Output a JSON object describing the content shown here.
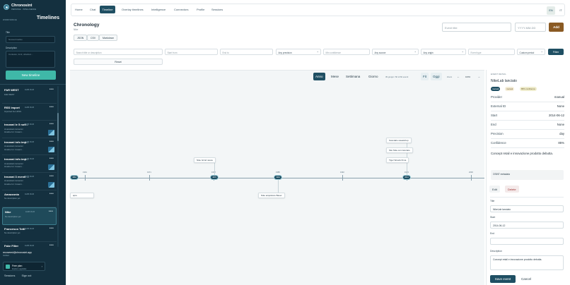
{
  "app": {
    "name": "Chronosint",
    "subtitle": "PERSONAL · INTELLIGENCE"
  },
  "sidebar": {
    "workspace_label": "WORKSPACE",
    "section_title": "Timelines",
    "title_label": "Title",
    "title_placeholder": "Nuova timeline",
    "description_label": "Description",
    "description_placeholder": "Contesto, fonti, obiettivo...",
    "new_button": "New timeline",
    "timelines": [
      {
        "name": "FAR WEST",
        "date": "11/08 16:26",
        "desc": "FAR WEST",
        "desc2": "",
        "thumb": false
      },
      {
        "name": "RSS import",
        "date": "11/08 16:26",
        "desc": "Imported from RSS",
        "desc2": "",
        "thumb": false
      },
      {
        "name": "trovami le 5 noti...",
        "date": "11/08 16:26",
        "desc": "AI-assisted connector",
        "desc2": "timeline for: trovami...",
        "thumb": true
      },
      {
        "name": "trovami info imp...",
        "date": "11/08 16:26",
        "desc": "AI-assisted connector",
        "desc2": "timeline for: trovami...",
        "thumb": true
      },
      {
        "name": "trovami info imp...",
        "date": "11/08 16:26",
        "desc": "AI-assisted connector",
        "desc2": "timeline for: trovami...",
        "thumb": true
      },
      {
        "name": "trovami 3 eventi ...",
        "date": "11/08 16:26",
        "desc": "AI-assisted connector",
        "desc2": "timeline for: trovami...",
        "thumb": true
      },
      {
        "name": "Amazzonia",
        "date": "11/08 16:26",
        "desc": "No description yet",
        "desc2": "",
        "thumb": false
      },
      {
        "name": "Nike",
        "date": "11/08 16:26",
        "desc": "No description yet",
        "desc2": "",
        "thumb": false,
        "active": true
      },
      {
        "name": "Francesco Totti",
        "date": "11/08 16:26",
        "desc": "No description yet",
        "desc2": "",
        "thumb": false
      },
      {
        "name": "Fake Filter",
        "date": "11/08 16:26",
        "desc": "No description yet",
        "desc2": "",
        "thumb": false
      }
    ],
    "account_email": "recovered@chronosint.app",
    "account_role": "Verified",
    "plan_name": "Free plan",
    "plan_sub": "Explore upgrades",
    "footer": {
      "sessions": "Sessions",
      "signout": "Sign out"
    }
  },
  "nav": {
    "items": [
      "Home",
      "Chat",
      "Timeline",
      "Overlay timelines",
      "Intelligence",
      "Connectors",
      "Profile",
      "Sessions"
    ],
    "active": "Timeline",
    "lang": [
      "EN",
      "IT"
    ]
  },
  "header": {
    "title": "Chronology",
    "subtitle": "Nike",
    "export": [
      "JSON",
      "CSV",
      "Markdown"
    ],
    "event_title_placeholder": "Event title",
    "date_placeholder": "YYYY-MM-DD",
    "add_label": "Add"
  },
  "filters": {
    "search_placeholder": "Search title or description",
    "start_placeholder": "Start from",
    "end_placeholder": "End to",
    "precision": "Any precision",
    "min_conf_placeholder": "Min confidence",
    "source": "Any source",
    "origin": "Any origin",
    "event_type_placeholder": "Event type",
    "period": "Custom period",
    "filter_button": "Filter",
    "reset_button": "Reset"
  },
  "timeline": {
    "zoom": [
      "Anno",
      "Mese",
      "Settimana",
      "Giorno"
    ],
    "active_zoom": "Anno",
    "groups_info": "39 gruppi / 60 di 60 eventi",
    "fit_label": "Fit",
    "today_label": "Oggi",
    "zoom_label": "Zoom",
    "zoom_value": "100%",
    "ticks": [
      "1964",
      "1971",
      "1978",
      "1985",
      "1992",
      "1999",
      "2006",
      "2013"
    ],
    "pills": [
      "1964",
      "1976",
      "1994",
      "2014"
    ],
    "events": [
      {
        "label": "Nike Grind nasce"
      },
      {
        "label": "Scandalo sweatshop"
      },
      {
        "label": "Sito Nike.com lanciato"
      },
      {
        "label": "Tiger Woods firma"
      },
      {
        "label": "Nike acquisisce Bauer"
      },
      {
        "label": "apre"
      }
    ]
  },
  "detail": {
    "heading": "EVENT DETAIL",
    "title": "NikeLab lanciato",
    "badges": [
      "manual",
      "manual",
      "85% confidence"
    ],
    "rows": [
      {
        "k": "Provider",
        "v": "manual"
      },
      {
        "k": "External ID",
        "v": "None"
      },
      {
        "k": "Start",
        "v": "2014-06-12"
      },
      {
        "k": "End",
        "v": "None"
      },
      {
        "k": "Precision",
        "v": "day"
      },
      {
        "k": "Confidence",
        "v": "85%"
      }
    ],
    "description": "Concept retail e innovazione prodotto debutta.",
    "meta_label": "OSINT metadata",
    "edit_label": "Edit",
    "delete_label": "Delete",
    "form": {
      "title_label": "Title",
      "title_value": "NikeLab lanciato",
      "start_label": "Start",
      "start_value": "2014-06-12",
      "end_label": "End",
      "end_value": "",
      "desc_label": "Description",
      "desc_value": "Concept retail e innovazione prodotto debutta."
    },
    "save_label": "Save event",
    "cancel_label": "Cancel"
  },
  "colors": {
    "sidebar_bg": "#14303f",
    "accent": "#1f4f63",
    "new_button": "#3fb8a8",
    "add_button": "#8a5a23"
  }
}
